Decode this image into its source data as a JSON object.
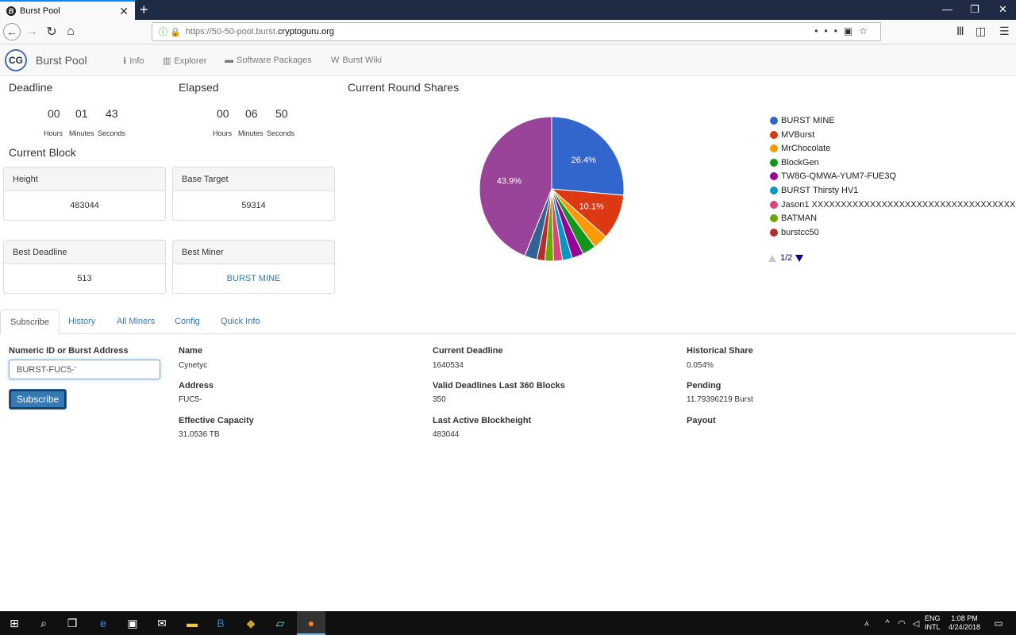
{
  "browser": {
    "tab_title": "Burst Pool",
    "favicon": "B",
    "url_path": "https://50-50-pool.burst.",
    "url_host": "cryptoguru.org"
  },
  "site": {
    "logo": "CG",
    "brand": "Burst Pool",
    "nav": [
      {
        "icon": "info-icon",
        "label": "Info"
      },
      {
        "icon": "bar-chart-icon",
        "label": "Explorer"
      },
      {
        "icon": "package-icon",
        "label": "Software Packages"
      },
      {
        "icon": "wiki-icon",
        "label": "Burst Wiki"
      }
    ]
  },
  "deadline": {
    "title": "Deadline",
    "hours": "00",
    "minutes": "01",
    "seconds": "43",
    "lbl_hours": "Hours",
    "lbl_minutes": "Minutes",
    "lbl_seconds": "Seconds"
  },
  "elapsed": {
    "title": "Elapsed",
    "hours": "00",
    "minutes": "06",
    "seconds": "50",
    "lbl_hours": "Hours",
    "lbl_minutes": "Minutes",
    "lbl_seconds": "Seconds"
  },
  "current_block": {
    "title": "Current Block",
    "height_label": "Height",
    "height": "483044",
    "base_target_label": "Base Target",
    "base_target": "59314",
    "best_deadline_label": "Best Deadline",
    "best_deadline": "513",
    "best_miner_label": "Best Miner",
    "best_miner": "BURST MINE"
  },
  "shares": {
    "title": "Current Round Shares",
    "pager": "1/2"
  },
  "chart_data": {
    "type": "pie",
    "title": "Current Round Shares",
    "slices": [
      {
        "name": "BURST MINE",
        "value": 26.4,
        "color": "#3366cc",
        "label": "26.4%"
      },
      {
        "name": "MVBurst",
        "value": 10.1,
        "color": "#dc3912",
        "label": "10.1%"
      },
      {
        "name": "MrChocolate",
        "value": 3.3,
        "color": "#ff9900",
        "label": ""
      },
      {
        "name": "BlockGen",
        "value": 3.0,
        "color": "#109618",
        "label": ""
      },
      {
        "name": "TW8G-QMWA-YUM7-FUE3Q",
        "value": 2.6,
        "color": "#990099",
        "label": ""
      },
      {
        "name": "BURST Thirsty HV1",
        "value": 2.2,
        "color": "#0099c6",
        "label": ""
      },
      {
        "name": "Jason1 XXXXXXXXXXXXXXXXXXXXXXXXXXXXXXXXXXXXXXXX...",
        "value": 2.0,
        "color": "#dd4477",
        "label": ""
      },
      {
        "name": "BATMAN",
        "value": 1.9,
        "color": "#66aa00",
        "label": ""
      },
      {
        "name": "burstcc50",
        "value": 1.8,
        "color": "#b82e2e",
        "label": ""
      },
      {
        "name": "",
        "value": 2.8,
        "color": "#316395",
        "label": ""
      },
      {
        "name": "",
        "value": 43.9,
        "color": "#994499",
        "label": "43.9%"
      }
    ],
    "legend_position": "right"
  },
  "tabs": [
    "Subscribe",
    "History",
    "All Miners",
    "Config",
    "Quick Info"
  ],
  "subscribe": {
    "field_label": "Numeric ID or Burst Address",
    "field_value": "BURST-FUC5-'",
    "button": "Subscribe"
  },
  "info": {
    "name_label": "Name",
    "name": "Cynetyc",
    "address_label": "Address",
    "address": "FUC5-",
    "capacity_label": "Effective Capacity",
    "capacity": "31.0536 TB",
    "cur_deadline_label": "Current Deadline",
    "cur_deadline": "1640534",
    "valid_label": "Valid Deadlines Last 360 Blocks",
    "valid": "350",
    "last_active_label": "Last Active Blockheight",
    "last_active": "483044",
    "hist_share_label": "Historical Share",
    "hist_share": "0.054%",
    "pending_label": "Pending",
    "pending": "11.79396219 Burst",
    "payout_label": "Payout"
  },
  "taskbar": {
    "lang1": "ENG",
    "lang2": "INTL",
    "time": "1:08 PM",
    "date": "4/24/2018"
  }
}
